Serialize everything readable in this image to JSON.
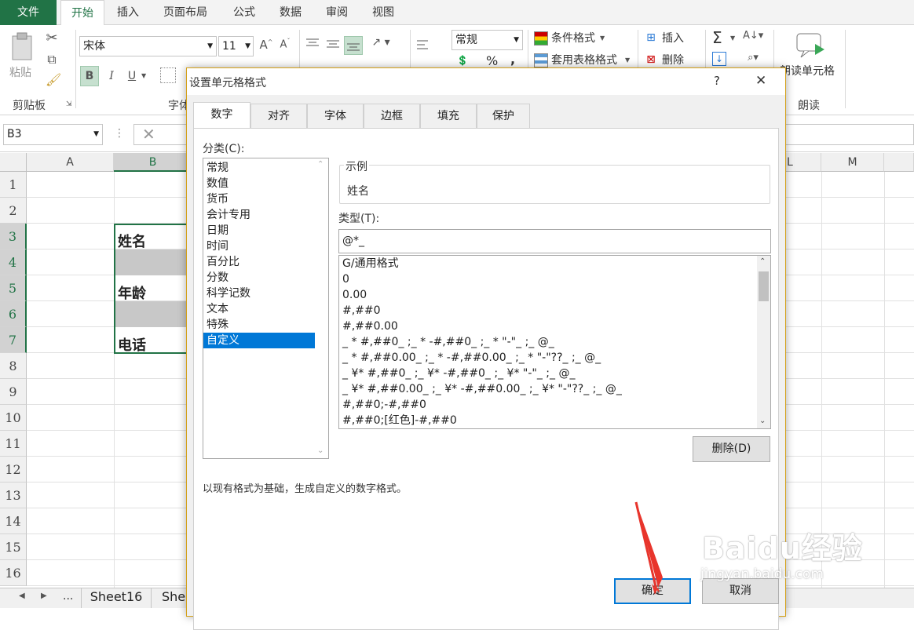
{
  "ribbon_tabs": [
    "文件",
    "开始",
    "插入",
    "页面布局",
    "公式",
    "数据",
    "审阅",
    "视图"
  ],
  "clipboard": {
    "paste_label": "粘贴",
    "group_label": "剪贴板"
  },
  "font": {
    "name": "宋体",
    "size": "11",
    "bold": "B",
    "italic": "I",
    "underline": "U",
    "group_label": "字体"
  },
  "number": {
    "format": "常规",
    "percent": "%",
    "comma": ","
  },
  "styles": {
    "conditional": "条件格式",
    "table": "套用表格格式"
  },
  "cells": {
    "insert": "插入",
    "delete": "删除"
  },
  "editing": {
    "sum": "Σ"
  },
  "read": {
    "read_cell": "朗读单元格",
    "group_label": "朗读"
  },
  "formula_bar": {
    "name_box": "B3"
  },
  "grid": {
    "columns": [
      "A",
      "B",
      "L",
      "M"
    ],
    "rows": [
      "1",
      "2",
      "3",
      "4",
      "5",
      "6",
      "7",
      "8",
      "9",
      "10",
      "11",
      "12",
      "13",
      "14",
      "15",
      "16"
    ],
    "cell_values": {
      "b3": "姓名",
      "b5": "年龄",
      "b7": "电话"
    }
  },
  "sheet_tabs": {
    "ellipsis": "...",
    "tab1": "Sheet16",
    "tab2": "She"
  },
  "dialog": {
    "title": "设置单元格格式",
    "help": "?",
    "close": "✕",
    "tabs": [
      "数字",
      "对齐",
      "字体",
      "边框",
      "填充",
      "保护"
    ],
    "category_label": "分类(C):",
    "categories": [
      "常规",
      "数值",
      "货币",
      "会计专用",
      "日期",
      "时间",
      "百分比",
      "分数",
      "科学记数",
      "文本",
      "特殊",
      "自定义"
    ],
    "selected_category": "自定义",
    "sample_label": "示例",
    "sample_value": "姓名",
    "type_label": "类型(T):",
    "type_value": "@*_",
    "type_list": [
      "G/通用格式",
      "0",
      "0.00",
      "#,##0",
      "#,##0.00",
      "_ * #,##0_ ;_ * -#,##0_ ;_ * \"-\"_ ;_ @_",
      "_ * #,##0.00_ ;_ * -#,##0.00_ ;_ * \"-\"??_ ;_ @_",
      "_ ¥* #,##0_ ;_ ¥* -#,##0_ ;_ ¥* \"-\"_ ;_ @_",
      "_ ¥* #,##0.00_ ;_ ¥* -#,##0.00_ ;_ ¥* \"-\"??_ ;_ @_",
      "#,##0;-#,##0",
      "#,##0;[红色]-#,##0"
    ],
    "delete_button": "删除(D)",
    "description": "以现有格式为基础，生成自定义的数字格式。",
    "ok": "确定",
    "cancel": "取消"
  },
  "watermark": {
    "text": "Baidu经验",
    "url": "jingyan.baidu.com"
  },
  "colors": {
    "excel_green": "#217346",
    "selection_blue": "#0078d7",
    "arrow_red": "#e8352c"
  }
}
